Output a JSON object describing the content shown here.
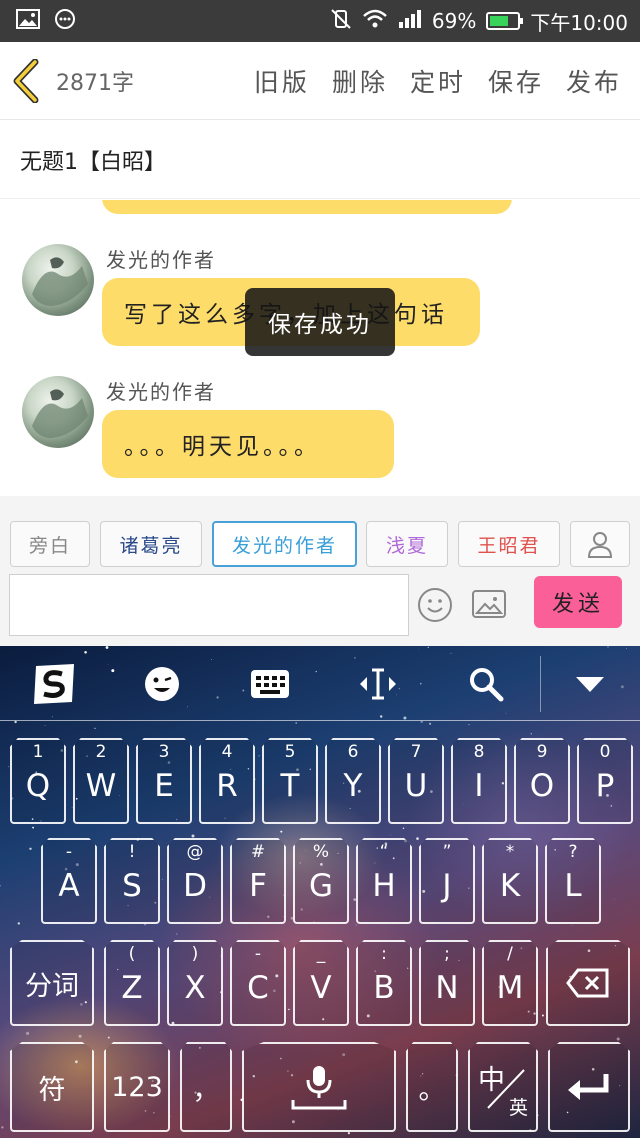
{
  "status_bar": {
    "battery": "69%",
    "battery_level": 0.69,
    "time": "下午10:00",
    "icons": [
      "image-icon",
      "more-icon",
      "vibrate-off-icon",
      "wifi-icon",
      "signal-icon",
      "battery-icon"
    ]
  },
  "header": {
    "word_count": "2871字",
    "actions": [
      "旧版",
      "删除",
      "定时",
      "保存",
      "发布"
    ]
  },
  "title": "无题1【白昭】",
  "messages": [
    {
      "author": "发光的作者",
      "text": "写了这么多字，加上这句话"
    },
    {
      "author": "发光的作者",
      "text": "。。。明天见。。。"
    }
  ],
  "toast": "保存成功",
  "roles": [
    {
      "label": "旁白",
      "color": "#888888"
    },
    {
      "label": "诸葛亮",
      "color": "#2a4a8a"
    },
    {
      "label": "发光的作者",
      "color": "#3a9fd8"
    },
    {
      "label": "浅夏",
      "color": "#b06ad8"
    },
    {
      "label": "王昭君",
      "color": "#e0524e"
    }
  ],
  "composer": {
    "input_value": "",
    "send_label": "发送"
  },
  "keyboard": {
    "row1": [
      {
        "main": "Q",
        "sub": "1"
      },
      {
        "main": "W",
        "sub": "2"
      },
      {
        "main": "E",
        "sub": "3"
      },
      {
        "main": "R",
        "sub": "4"
      },
      {
        "main": "T",
        "sub": "5"
      },
      {
        "main": "Y",
        "sub": "6"
      },
      {
        "main": "U",
        "sub": "7"
      },
      {
        "main": "I",
        "sub": "8"
      },
      {
        "main": "O",
        "sub": "9"
      },
      {
        "main": "P",
        "sub": "0"
      }
    ],
    "row2": [
      {
        "main": "A",
        "sub": "-"
      },
      {
        "main": "S",
        "sub": "!"
      },
      {
        "main": "D",
        "sub": "@"
      },
      {
        "main": "F",
        "sub": "#"
      },
      {
        "main": "G",
        "sub": "%"
      },
      {
        "main": "H",
        "sub": "“"
      },
      {
        "main": "J",
        "sub": "”"
      },
      {
        "main": "K",
        "sub": "*"
      },
      {
        "main": "L",
        "sub": "?"
      }
    ],
    "row3_left": "分词",
    "row3": [
      {
        "main": "Z",
        "sub": "("
      },
      {
        "main": "X",
        "sub": ")"
      },
      {
        "main": "C",
        "sub": "-"
      },
      {
        "main": "V",
        "sub": "_"
      },
      {
        "main": "B",
        "sub": ":"
      },
      {
        "main": "N",
        "sub": ";"
      },
      {
        "main": "M",
        "sub": "/"
      }
    ],
    "row4": {
      "symbols": "符",
      "numbers": "123",
      "comma": "，",
      "period": "。",
      "lang_main": "中",
      "lang_sub": "英"
    }
  }
}
